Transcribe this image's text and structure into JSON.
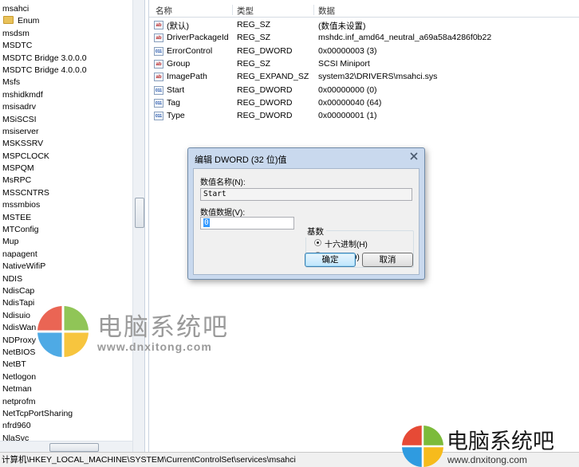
{
  "tree": {
    "items": [
      {
        "label": "msahci",
        "child": false
      },
      {
        "label": "Enum",
        "child": true
      },
      {
        "label": "msdsm",
        "child": false
      },
      {
        "label": "MSDTC",
        "child": false
      },
      {
        "label": "MSDTC Bridge 3.0.0.0",
        "child": false
      },
      {
        "label": "MSDTC Bridge 4.0.0.0",
        "child": false
      },
      {
        "label": "Msfs",
        "child": false
      },
      {
        "label": "mshidkmdf",
        "child": false
      },
      {
        "label": "msisadrv",
        "child": false
      },
      {
        "label": "MSiSCSI",
        "child": false
      },
      {
        "label": "msiserver",
        "child": false
      },
      {
        "label": "MSKSSRV",
        "child": false
      },
      {
        "label": "MSPCLOCK",
        "child": false
      },
      {
        "label": "MSPQM",
        "child": false
      },
      {
        "label": "MsRPC",
        "child": false
      },
      {
        "label": "MSSCNTRS",
        "child": false
      },
      {
        "label": "mssmbios",
        "child": false
      },
      {
        "label": "MSTEE",
        "child": false
      },
      {
        "label": "MTConfig",
        "child": false
      },
      {
        "label": "Mup",
        "child": false
      },
      {
        "label": "napagent",
        "child": false
      },
      {
        "label": "NativeWifiP",
        "child": false
      },
      {
        "label": "NDIS",
        "child": false
      },
      {
        "label": "NdisCap",
        "child": false
      },
      {
        "label": "NdisTapi",
        "child": false
      },
      {
        "label": "Ndisuio",
        "child": false
      },
      {
        "label": "NdisWan",
        "child": false
      },
      {
        "label": "NDProxy",
        "child": false
      },
      {
        "label": "NetBIOS",
        "child": false
      },
      {
        "label": "NetBT",
        "child": false
      },
      {
        "label": "Netlogon",
        "child": false
      },
      {
        "label": "Netman",
        "child": false
      },
      {
        "label": "netprofm",
        "child": false
      },
      {
        "label": "NetTcpPortSharing",
        "child": false
      },
      {
        "label": "nfrd960",
        "child": false
      },
      {
        "label": "NlaSvc",
        "child": false
      }
    ]
  },
  "values": {
    "headers": {
      "name": "名称",
      "type": "类型",
      "data": "数据"
    },
    "rows": [
      {
        "icon": "ab",
        "name": "(默认)",
        "type": "REG_SZ",
        "data": "(数值未设置)"
      },
      {
        "icon": "ab",
        "name": "DriverPackageId",
        "type": "REG_SZ",
        "data": "mshdc.inf_amd64_neutral_a69a58a4286f0b22"
      },
      {
        "icon": "bin",
        "name": "ErrorControl",
        "type": "REG_DWORD",
        "data": "0x00000003 (3)"
      },
      {
        "icon": "ab",
        "name": "Group",
        "type": "REG_SZ",
        "data": "SCSI Miniport"
      },
      {
        "icon": "ab",
        "name": "ImagePath",
        "type": "REG_EXPAND_SZ",
        "data": "system32\\DRIVERS\\msahci.sys"
      },
      {
        "icon": "bin",
        "name": "Start",
        "type": "REG_DWORD",
        "data": "0x00000000 (0)"
      },
      {
        "icon": "bin",
        "name": "Tag",
        "type": "REG_DWORD",
        "data": "0x00000040 (64)"
      },
      {
        "icon": "bin",
        "name": "Type",
        "type": "REG_DWORD",
        "data": "0x00000001 (1)"
      }
    ]
  },
  "dialog": {
    "title": "编辑 DWORD (32 位)值",
    "value_name_label": "数值名称(N):",
    "value_name": "Start",
    "value_data_label": "数值数据(V):",
    "value_data": "0",
    "base_label": "基数",
    "radix_hex": "十六进制(H)",
    "radix_dec": "十进制(D)",
    "radix_selected": "hex",
    "ok": "确定",
    "cancel": "取消"
  },
  "statusbar": {
    "path": "计算机\\HKEY_LOCAL_MACHINE\\SYSTEM\\CurrentControlSet\\services\\msahci"
  },
  "watermark": {
    "title": "电脑系统吧",
    "url": "www.dnxitong.com",
    "title2": "电脑系统吧",
    "url2": "www.dnxitong.com"
  },
  "colors": {
    "logo_red": "#e64a36",
    "logo_green": "#7cbb3a",
    "logo_blue": "#2f9be0",
    "logo_yellow": "#f6bb1c"
  }
}
